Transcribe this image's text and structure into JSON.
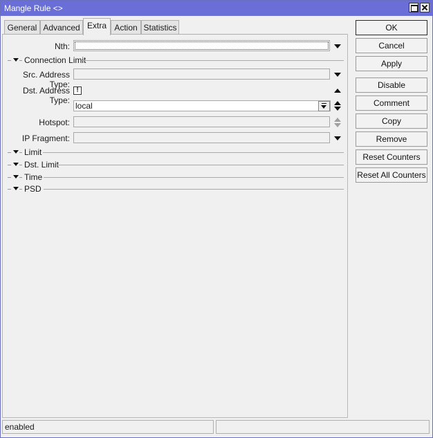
{
  "window": {
    "title": "Mangle Rule <>"
  },
  "tabs": [
    {
      "label": "General"
    },
    {
      "label": "Advanced"
    },
    {
      "label": "Extra"
    },
    {
      "label": "Action"
    },
    {
      "label": "Statistics"
    }
  ],
  "active_tab": "Extra",
  "form": {
    "nth_label": "Nth:",
    "nth_value": "",
    "connection_limit_label": "Connection Limit",
    "src_address_type_label": "Src. Address Type:",
    "src_address_type_value": "",
    "dst_address_type_label": "Dst. Address Type:",
    "dst_address_type_negate": "!",
    "dst_address_type_value": "local",
    "hotspot_label": "Hotspot:",
    "hotspot_value": "",
    "ip_fragment_label": "IP Fragment:",
    "ip_fragment_value": "",
    "sections": {
      "limit": "Limit",
      "dst_limit": "Dst. Limit",
      "time": "Time",
      "psd": "PSD"
    }
  },
  "buttons": {
    "ok": "OK",
    "cancel": "Cancel",
    "apply": "Apply",
    "disable": "Disable",
    "comment": "Comment",
    "copy": "Copy",
    "remove": "Remove",
    "reset_counters": "Reset Counters",
    "reset_all_counters": "Reset All Counters"
  },
  "status": {
    "state": "enabled",
    "secondary": ""
  },
  "colors": {
    "titlebar": "#6a6fd8",
    "background": "#f0f0f0"
  },
  "icons": {
    "maximize": "maximize-icon",
    "close": "close-icon",
    "dropdown": "chevron-down-icon",
    "collapse": "chevron-up-icon",
    "section_toggle": "triangle-down-icon"
  }
}
